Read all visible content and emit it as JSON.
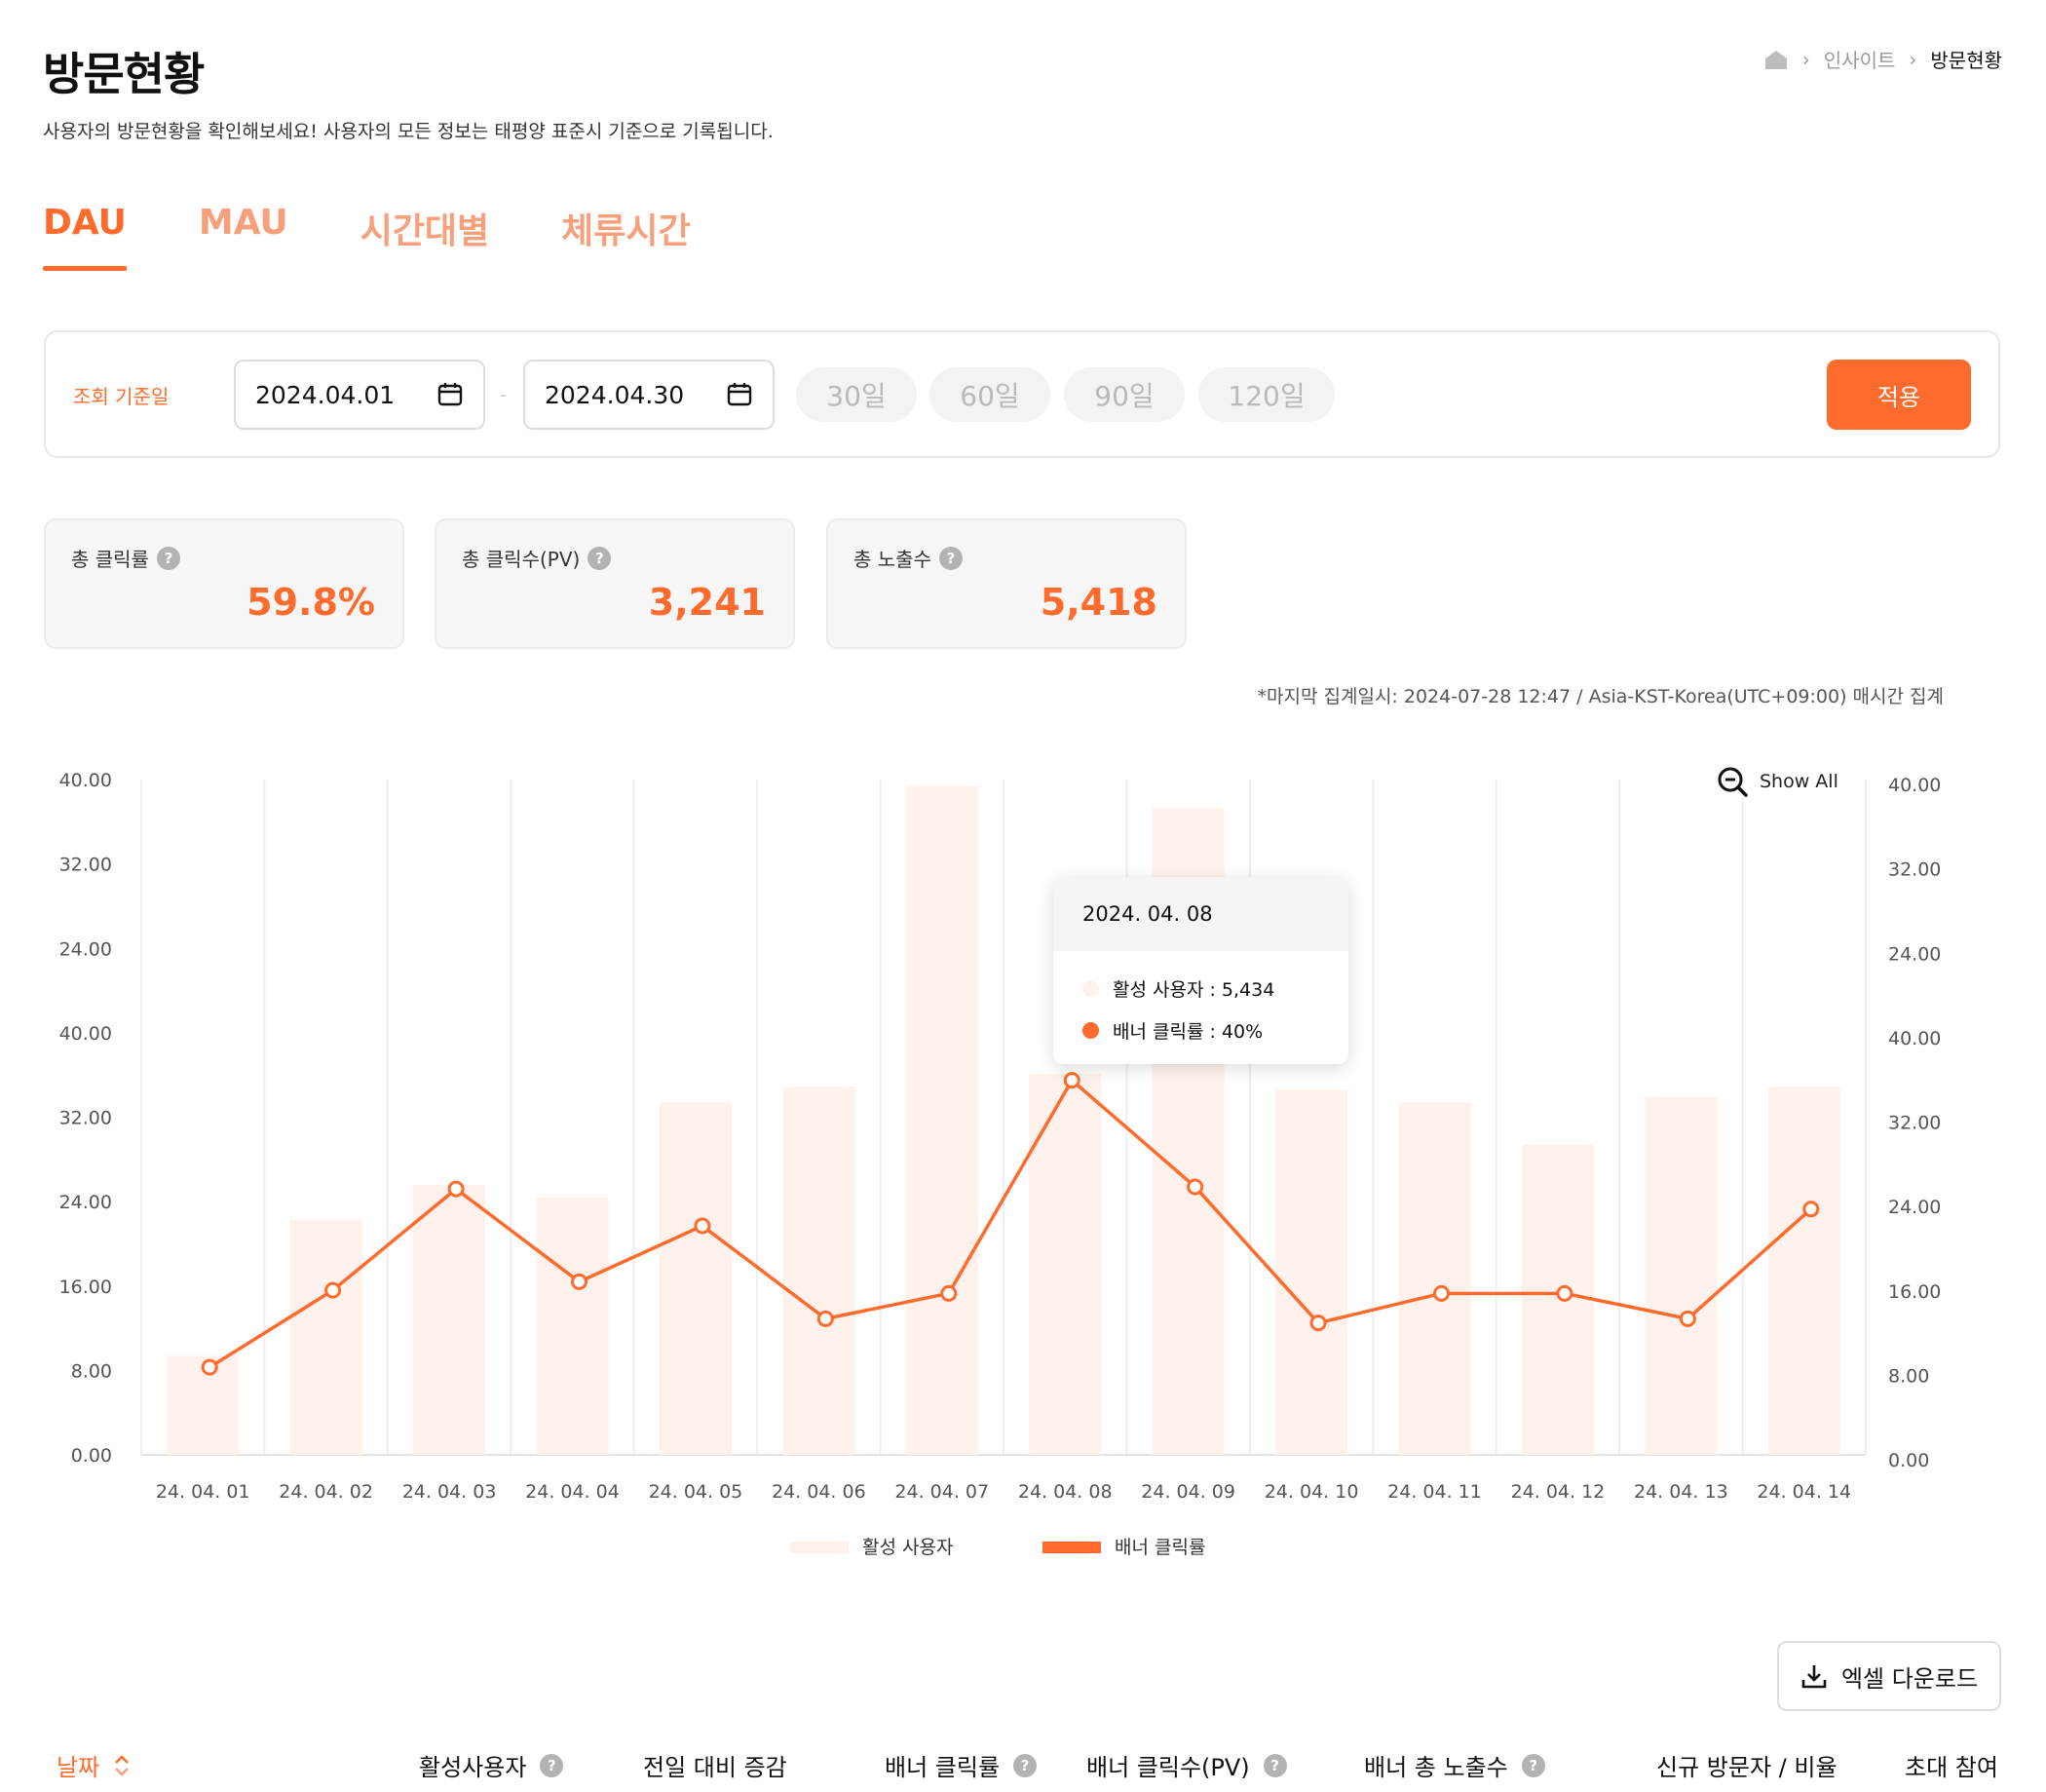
{
  "header": {
    "title": "방문현황",
    "description": "사용자의 방문현황을 확인해보세요! 사용자의 모든 정보는 태평양 표준시 기준으로 기록됩니다.",
    "breadcrumb": [
      "인사이트",
      "방문현황"
    ]
  },
  "tabs": [
    {
      "label": "DAU",
      "active": true
    },
    {
      "label": "MAU",
      "active": false
    },
    {
      "label": "시간대별",
      "active": false
    },
    {
      "label": "체류시간",
      "active": false
    }
  ],
  "filter": {
    "label": "조회 기준일",
    "start_date": "2024.04.01",
    "end_date": "2024.04.30",
    "separator": "-",
    "ranges": [
      "30일",
      "60일",
      "90일",
      "120일"
    ],
    "apply_label": "적용"
  },
  "stats": [
    {
      "label": "총 클릭률",
      "value": "59.8%"
    },
    {
      "label": "총 클릭수(PV)",
      "value": "3,241"
    },
    {
      "label": "총 노출수",
      "value": "5,418"
    }
  ],
  "note": "*마지막 집계일시: 2024-07-28 12:47 / Asia-KST-Korea(UTC+09:00) 매시간 집계",
  "show_all_label": "Show All",
  "tooltip": {
    "date": "2024. 04. 08",
    "active_users": "활성 사용자 : 5,434",
    "banner_ctr": "배너 클릭률 : 40%"
  },
  "chart_data": {
    "type": "bar",
    "categories": [
      "24. 04. 01",
      "24. 04. 02",
      "24. 04. 03",
      "24. 04. 04",
      "24. 04. 05",
      "24. 04. 06",
      "24. 04. 07",
      "24. 04. 08",
      "24. 04. 09",
      "24. 04. 10",
      "24. 04. 11",
      "24. 04. 12",
      "24. 04. 13",
      "24. 04. 14"
    ],
    "left_tick_labels": [
      "40.00",
      "32.00",
      "24.00",
      "40.00",
      "32.00",
      "24.00",
      "16.00",
      "8.00",
      "0.00"
    ],
    "right_tick_labels": [
      "40.00",
      "32.00",
      "24.00",
      "40.00",
      "32.00",
      "24.00",
      "16.00",
      "8.00",
      "0.00"
    ],
    "ylim": [
      0,
      64
    ],
    "grid": true,
    "legend_position": "bottom",
    "series": [
      {
        "name": "활성 사용자",
        "type": "bar",
        "color": "#fff1ec",
        "values": [
          9.4,
          22.3,
          25.6,
          24.4,
          33.4,
          34.9,
          63.4,
          36.1,
          61.3,
          34.6,
          33.4,
          29.4,
          33.9,
          34.9
        ]
      },
      {
        "name": "배너 클릭률",
        "type": "line",
        "color": "#ff6b2c",
        "values": [
          8.3,
          15.6,
          25.2,
          16.4,
          21.7,
          12.9,
          15.3,
          35.5,
          25.4,
          12.5,
          15.3,
          15.3,
          12.9,
          23.3
        ]
      }
    ]
  },
  "excel_label": "엑셀 다운로드",
  "table": {
    "headers": [
      "날짜",
      "활성사용자",
      "전일 대비 증감",
      "배너 클릭률",
      "배너 클릭수(PV)",
      "배너 총 노출수",
      "신규 방문자 / 비율",
      "초대 참여"
    ]
  },
  "colors": {
    "accent": "#ff6b2c",
    "accent_light": "#f7a07b",
    "bar": "#fff1ec"
  }
}
